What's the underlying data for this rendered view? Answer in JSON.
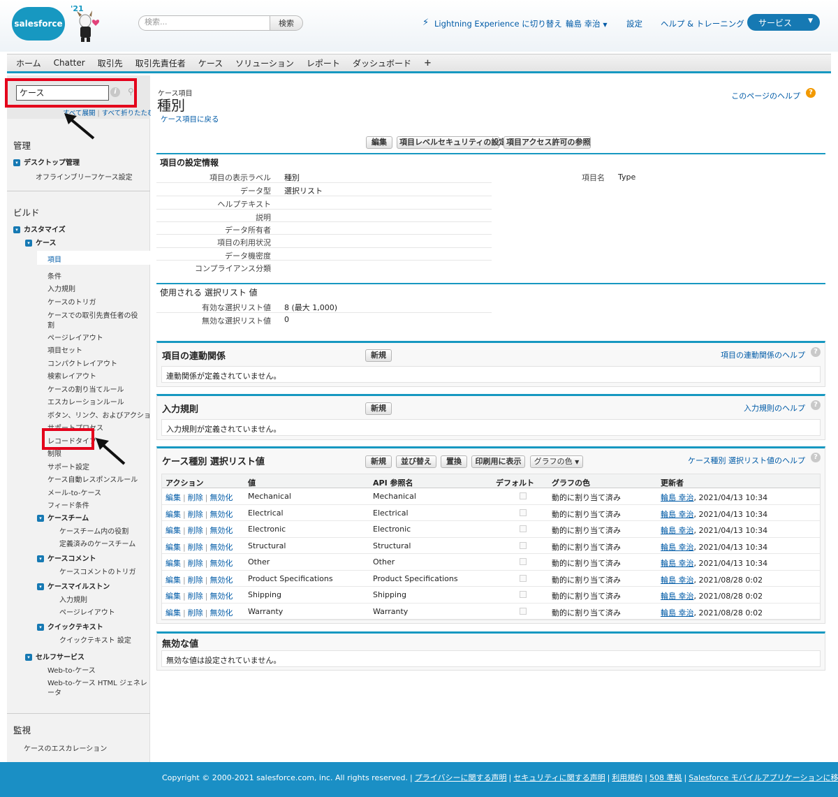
{
  "header": {
    "logo_text": "salesforce",
    "year_badge": "'21",
    "search_placeholder": "検索...",
    "search_button": "検索",
    "lightning_link": "Lightning Experience に切り替え",
    "user_menu": "輪島 幸治",
    "setup_link": "設定",
    "help_link": "ヘルプ & トレーニング",
    "app_menu": "サービス",
    "colors": {
      "brand": "#1798c1",
      "app_menu": "#1679b3"
    }
  },
  "tabs": [
    {
      "label": "ホーム"
    },
    {
      "label": "Chatter"
    },
    {
      "label": "取引先"
    },
    {
      "label": "取引先責任者"
    },
    {
      "label": "ケース"
    },
    {
      "label": "ソリューション"
    },
    {
      "label": "レポート"
    },
    {
      "label": "ダッシュボード"
    }
  ],
  "tab_add_icon": "+",
  "sidebar": {
    "quickfind_value": "ケース",
    "expand_all": "すべて展開",
    "collapse_all": "すべて折りたたむ",
    "sections": {
      "admin": "管理",
      "build": "ビルド",
      "monitor": "監視"
    },
    "items": {
      "desktop_admin": "デスクトップ管理",
      "offline_briefcase": "オフラインブリーフケース設定",
      "customize": "カスタマイズ",
      "case": "ケース",
      "fields": "項目",
      "conditions": "条件",
      "validation_rules": "入力規則",
      "case_triggers": "ケースのトリガ",
      "case_contact_roles_1": "ケースでの取引先責任者の役",
      "case_contact_roles_2": "割",
      "page_layouts": "ページレイアウト",
      "field_sets": "項目セット",
      "compact_layouts": "コンパクトレイアウト",
      "search_layouts": "検索レイアウト",
      "assignment_rules": "ケースの割り当てルール",
      "escalation_rules": "エスカレーションルール",
      "buttons_links_actions": "ボタン、リンク、およびアクション",
      "support_process": "サポートプロセス",
      "record_types": "レコードタイプ",
      "limits": "制限",
      "support_settings": "サポート設定",
      "auto_response": "ケース自動レスポンスルール",
      "email_to_case": "メール-to-ケース",
      "feed_filters": "フィード条件",
      "case_teams": "ケースチーム",
      "case_team_roles": "ケースチーム内の役割",
      "predefined_teams": "定義済みのケースチーム",
      "case_comments": "ケースコメント",
      "case_comment_triggers": "ケースコメントのトリガ",
      "case_milestones": "ケースマイルストン",
      "milestone_validation": "入力規則",
      "milestone_layouts": "ページレイアウト",
      "quick_text": "クイックテキスト",
      "quick_text_settings": "クイックテキスト 設定",
      "self_service": "セルフサービス",
      "web_to_case": "Web-to-ケース",
      "web_to_case_html_1": "Web-to-ケース HTML ジェネレ",
      "web_to_case_html_2": "ータ",
      "case_escalation": "ケースのエスカレーション"
    }
  },
  "main": {
    "object_label": "ケース項目",
    "title": "種別",
    "back_link": "ケース項目に戻る",
    "page_help": "このページのヘルプ",
    "buttons": {
      "edit": "編集",
      "field_security": "項目レベルセキュリティの設定",
      "view_access": "項目アクセス許可の参照"
    },
    "field_info": {
      "title": "項目の設定情報",
      "label_k": "項目の表示ラベル",
      "label_v": "種別",
      "type_k": "データ型",
      "type_v": "選択リスト",
      "help_k": "ヘルプテキスト",
      "desc_k": "説明",
      "owner_k": "データ所有者",
      "usage_k": "項目の利用状況",
      "sensitivity_k": "データ機密度",
      "compliance_k": "コンプライアンス分類",
      "name_k": "項目名",
      "name_v": "Type"
    },
    "picklist_usage": {
      "title": "使用される 選択リスト 値",
      "active_k": "有効な選択リスト値",
      "active_v": "8 (最大 1,000)",
      "inactive_k": "無効な選択リスト値",
      "inactive_v": "0"
    },
    "dependencies": {
      "title": "項目の連動関係",
      "new": "新規",
      "help": "項目の連動関係のヘルプ",
      "empty": "連動関係が定義されていません。"
    },
    "validation": {
      "title": "入力規則",
      "new": "新規",
      "help": "入力規則のヘルプ",
      "empty": "入力規則が定義されていません。"
    },
    "picklist": {
      "title": "ケース種別 選択リスト値",
      "btn_new": "新規",
      "btn_sort": "並び替え",
      "btn_replace": "置換",
      "btn_print": "印刷用に表示",
      "btn_chart": "グラフの色",
      "help": "ケース種別 選択リスト値のヘルプ",
      "columns": [
        "アクション",
        "値",
        "API 参照名",
        "デフォルト",
        "グラフの色",
        "更新者"
      ],
      "action_edit": "編集",
      "action_delete": "削除",
      "action_deactivate": "無効化",
      "rows": [
        {
          "value": "Mechanical",
          "api": "Mechanical",
          "color": "動的に割り当て済み",
          "user": "輪島 幸治",
          "date": ", 2021/04/13 10:34"
        },
        {
          "value": "Electrical",
          "api": "Electrical",
          "color": "動的に割り当て済み",
          "user": "輪島 幸治",
          "date": ", 2021/04/13 10:34"
        },
        {
          "value": "Electronic",
          "api": "Electronic",
          "color": "動的に割り当て済み",
          "user": "輪島 幸治",
          "date": ", 2021/04/13 10:34"
        },
        {
          "value": "Structural",
          "api": "Structural",
          "color": "動的に割り当て済み",
          "user": "輪島 幸治",
          "date": ", 2021/04/13 10:34"
        },
        {
          "value": "Other",
          "api": "Other",
          "color": "動的に割り当て済み",
          "user": "輪島 幸治",
          "date": ", 2021/04/13 10:34"
        },
        {
          "value": "Product Specifications",
          "api": "Product Specifications",
          "color": "動的に割り当て済み",
          "user": "輪島 幸治",
          "date": ", 2021/08/28 0:02"
        },
        {
          "value": "Shipping",
          "api": "Shipping",
          "color": "動的に割り当て済み",
          "user": "輪島 幸治",
          "date": ", 2021/08/28 0:02"
        },
        {
          "value": "Warranty",
          "api": "Warranty",
          "color": "動的に割り当て済み",
          "user": "輪島 幸治",
          "date": ", 2021/08/28 0:02"
        }
      ]
    },
    "inactive": {
      "title": "無効な値",
      "empty": "無効な値は設定されていません。"
    }
  },
  "footer": {
    "copyright": "Copyright © 2000-2021 salesforce.com, inc. All rights reserved.",
    "links": [
      "プライバシーに関する声明",
      "セキュリティに関する声明",
      "利用規約",
      "508 準拠",
      "Salesforce モバイルアプリケーションに移動"
    ],
    "color": "#1a8fc5"
  }
}
